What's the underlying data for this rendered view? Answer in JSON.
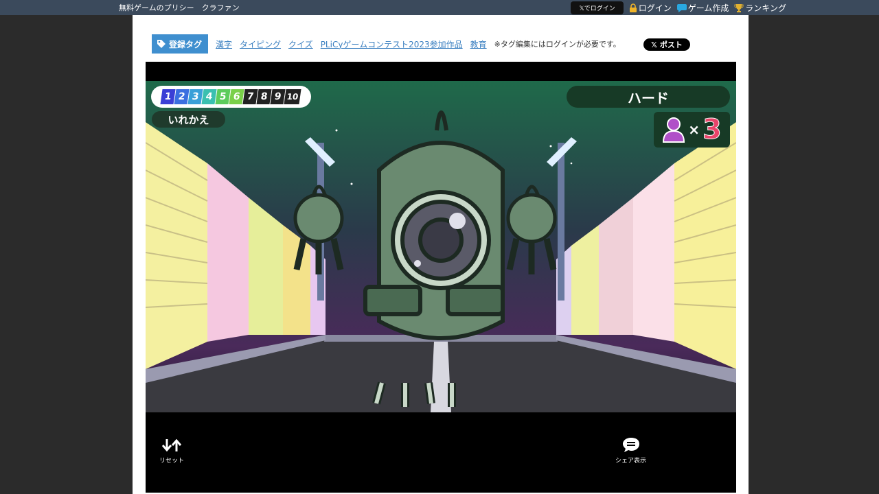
{
  "topbar": {
    "site_title": "無料ゲームのプリシー　クラファン",
    "x_login": "𝕏でログイン",
    "login": "ログイン",
    "create_game": "ゲーム作成",
    "ranking": "ランキング"
  },
  "tags": {
    "badge": "登録タグ",
    "items": [
      "漢字",
      "タイピング",
      "クイズ",
      "PLiCyゲームコンテスト2023参加作品",
      "教育"
    ],
    "note": "※タグ編集にはログインが必要です。",
    "x_post": "𝕏 ポスト"
  },
  "game": {
    "levels": [
      "1",
      "2",
      "3",
      "4",
      "5",
      "6",
      "7",
      "8",
      "9",
      "10"
    ],
    "level_colors": [
      "#3b3fd6",
      "#3b6fe0",
      "#3aa0d8",
      "#3ac0b0",
      "#5ccc5c",
      "#7ad04a",
      "#222222",
      "#222222",
      "#222222",
      "#222222"
    ],
    "swap_label": "いれかえ",
    "difficulty": "ハード",
    "players_times": "×",
    "players_count": "3",
    "reset_label": "リセット",
    "share_label": "シェア表示"
  }
}
